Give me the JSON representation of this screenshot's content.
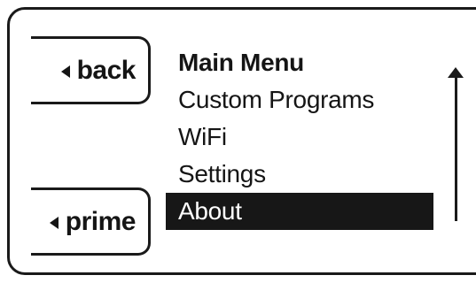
{
  "buttons": {
    "back_label": "back",
    "prime_label": "prime"
  },
  "menu": {
    "title": "Main Menu",
    "items": [
      {
        "label": "Custom Programs",
        "selected": false
      },
      {
        "label": "WiFi",
        "selected": false
      },
      {
        "label": "Settings",
        "selected": false
      },
      {
        "label": "About",
        "selected": true
      }
    ]
  },
  "icons": {
    "back": "left-triangle-icon",
    "prime": "left-triangle-icon",
    "scroll": "up-arrow-icon"
  },
  "colors": {
    "ink": "#1a1a1a",
    "background": "#ffffff",
    "selection": "#171717"
  }
}
